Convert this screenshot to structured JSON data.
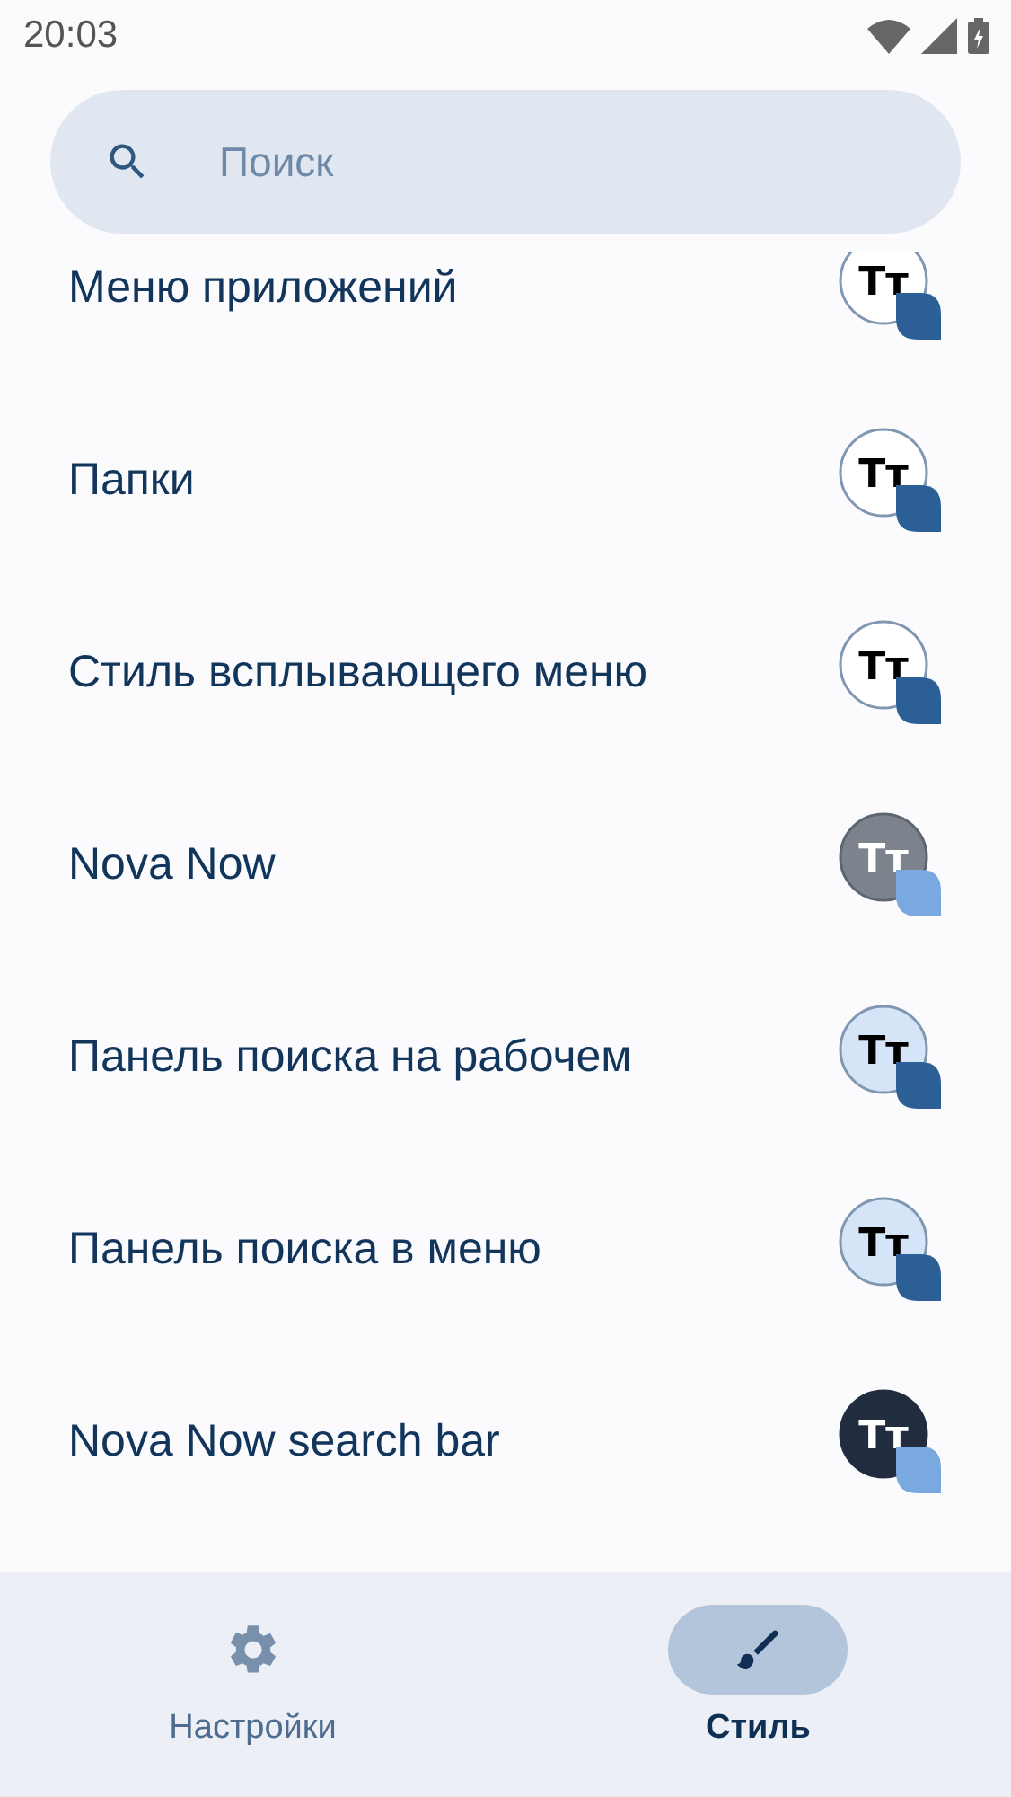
{
  "status_bar": {
    "time": "20:03"
  },
  "search": {
    "placeholder": "Поиск"
  },
  "items": [
    {
      "label": "Меню приложений",
      "badge": "Tт",
      "kind": "outline"
    },
    {
      "label": "Папки",
      "badge": "Tт",
      "kind": "outline"
    },
    {
      "label": "Стиль всплывающего меню",
      "badge": "Tт",
      "kind": "outline"
    },
    {
      "label": "Nova Now",
      "badge": "Tт",
      "kind": "grey"
    },
    {
      "label": "Панель поиска на рабочем",
      "badge": "Tт",
      "kind": "tinted"
    },
    {
      "label": "Панель поиска в меню",
      "badge": "Tт",
      "kind": "tinted"
    },
    {
      "label": "Nova Now search bar",
      "badge": "Tт",
      "kind": "dark"
    }
  ],
  "nav": [
    {
      "label": "Настройки",
      "kind": "gear",
      "selected": false
    },
    {
      "label": "Стиль",
      "kind": "brush",
      "selected": true
    }
  ]
}
